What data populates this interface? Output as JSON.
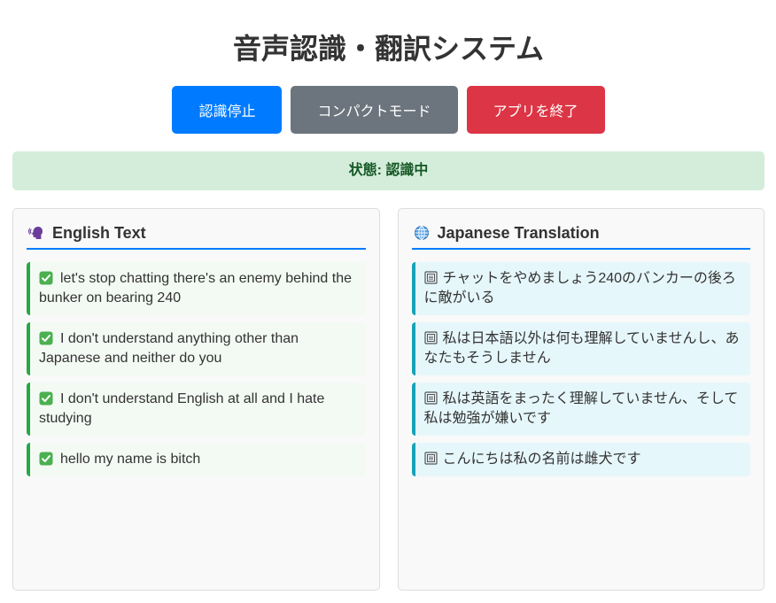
{
  "app": {
    "title": "音声認識・翻訳システム"
  },
  "controls": {
    "stop_label": "認識停止",
    "compact_mode_label": "コンパクトモード",
    "exit_label": "アプリを終了"
  },
  "status": {
    "label": "状態:",
    "value": "認識中"
  },
  "english_panel": {
    "title": "English Text",
    "icon": "speaking-head-icon",
    "items": [
      {
        "icon": "check-mark-icon",
        "text": "let's stop chatting there's an enemy behind the bunker on bearing 240"
      },
      {
        "icon": "check-mark-icon",
        "text": "I don't understand anything other than Japanese and neither do you"
      },
      {
        "icon": "check-mark-icon",
        "text": "I don't understand English at all and I hate studying"
      },
      {
        "icon": "check-mark-icon",
        "text": "hello my name is bitch"
      }
    ]
  },
  "japanese_panel": {
    "title": "Japanese Translation",
    "icon": "globe-icon",
    "items": [
      {
        "icon": "translation-icon",
        "text": "チャットをやめましょう240のバンカーの後ろに敵がいる"
      },
      {
        "icon": "translation-icon",
        "text": "私は日本語以外は何も理解していませんし、あなたもそうしません"
      },
      {
        "icon": "translation-icon",
        "text": "私は英語をまったく理解していません、そして私は勉強が嫌いです"
      },
      {
        "icon": "translation-icon",
        "text": "こんにちは私の名前は雌犬です"
      }
    ]
  },
  "theme": {
    "primary": "#007bff",
    "secondary": "#6c757d",
    "danger": "#dc3545",
    "status_bg": "#d4edda",
    "status_text": "#155724",
    "english_accent": "#28a745",
    "japanese_accent": "#17a2b8"
  }
}
